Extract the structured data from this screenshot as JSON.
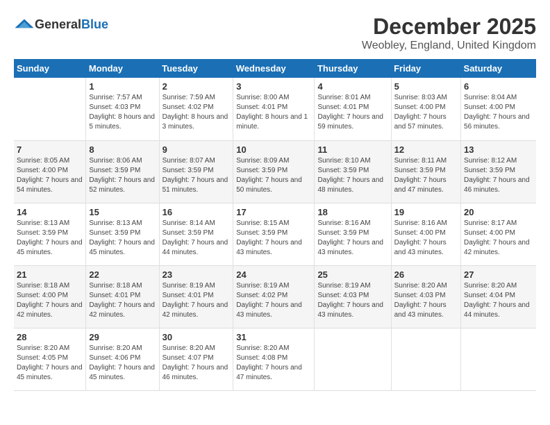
{
  "header": {
    "logo_general": "General",
    "logo_blue": "Blue",
    "month": "December 2025",
    "location": "Weobley, England, United Kingdom"
  },
  "days_of_week": [
    "Sunday",
    "Monday",
    "Tuesday",
    "Wednesday",
    "Thursday",
    "Friday",
    "Saturday"
  ],
  "weeks": [
    [
      {
        "day": "",
        "sunrise": "",
        "sunset": "",
        "daylight": ""
      },
      {
        "day": "1",
        "sunrise": "Sunrise: 7:57 AM",
        "sunset": "Sunset: 4:03 PM",
        "daylight": "Daylight: 8 hours and 5 minutes."
      },
      {
        "day": "2",
        "sunrise": "Sunrise: 7:59 AM",
        "sunset": "Sunset: 4:02 PM",
        "daylight": "Daylight: 8 hours and 3 minutes."
      },
      {
        "day": "3",
        "sunrise": "Sunrise: 8:00 AM",
        "sunset": "Sunset: 4:01 PM",
        "daylight": "Daylight: 8 hours and 1 minute."
      },
      {
        "day": "4",
        "sunrise": "Sunrise: 8:01 AM",
        "sunset": "Sunset: 4:01 PM",
        "daylight": "Daylight: 7 hours and 59 minutes."
      },
      {
        "day": "5",
        "sunrise": "Sunrise: 8:03 AM",
        "sunset": "Sunset: 4:00 PM",
        "daylight": "Daylight: 7 hours and 57 minutes."
      },
      {
        "day": "6",
        "sunrise": "Sunrise: 8:04 AM",
        "sunset": "Sunset: 4:00 PM",
        "daylight": "Daylight: 7 hours and 56 minutes."
      }
    ],
    [
      {
        "day": "7",
        "sunrise": "Sunrise: 8:05 AM",
        "sunset": "Sunset: 4:00 PM",
        "daylight": "Daylight: 7 hours and 54 minutes."
      },
      {
        "day": "8",
        "sunrise": "Sunrise: 8:06 AM",
        "sunset": "Sunset: 3:59 PM",
        "daylight": "Daylight: 7 hours and 52 minutes."
      },
      {
        "day": "9",
        "sunrise": "Sunrise: 8:07 AM",
        "sunset": "Sunset: 3:59 PM",
        "daylight": "Daylight: 7 hours and 51 minutes."
      },
      {
        "day": "10",
        "sunrise": "Sunrise: 8:09 AM",
        "sunset": "Sunset: 3:59 PM",
        "daylight": "Daylight: 7 hours and 50 minutes."
      },
      {
        "day": "11",
        "sunrise": "Sunrise: 8:10 AM",
        "sunset": "Sunset: 3:59 PM",
        "daylight": "Daylight: 7 hours and 48 minutes."
      },
      {
        "day": "12",
        "sunrise": "Sunrise: 8:11 AM",
        "sunset": "Sunset: 3:59 PM",
        "daylight": "Daylight: 7 hours and 47 minutes."
      },
      {
        "day": "13",
        "sunrise": "Sunrise: 8:12 AM",
        "sunset": "Sunset: 3:59 PM",
        "daylight": "Daylight: 7 hours and 46 minutes."
      }
    ],
    [
      {
        "day": "14",
        "sunrise": "Sunrise: 8:13 AM",
        "sunset": "Sunset: 3:59 PM",
        "daylight": "Daylight: 7 hours and 45 minutes."
      },
      {
        "day": "15",
        "sunrise": "Sunrise: 8:13 AM",
        "sunset": "Sunset: 3:59 PM",
        "daylight": "Daylight: 7 hours and 45 minutes."
      },
      {
        "day": "16",
        "sunrise": "Sunrise: 8:14 AM",
        "sunset": "Sunset: 3:59 PM",
        "daylight": "Daylight: 7 hours and 44 minutes."
      },
      {
        "day": "17",
        "sunrise": "Sunrise: 8:15 AM",
        "sunset": "Sunset: 3:59 PM",
        "daylight": "Daylight: 7 hours and 43 minutes."
      },
      {
        "day": "18",
        "sunrise": "Sunrise: 8:16 AM",
        "sunset": "Sunset: 3:59 PM",
        "daylight": "Daylight: 7 hours and 43 minutes."
      },
      {
        "day": "19",
        "sunrise": "Sunrise: 8:16 AM",
        "sunset": "Sunset: 4:00 PM",
        "daylight": "Daylight: 7 hours and 43 minutes."
      },
      {
        "day": "20",
        "sunrise": "Sunrise: 8:17 AM",
        "sunset": "Sunset: 4:00 PM",
        "daylight": "Daylight: 7 hours and 42 minutes."
      }
    ],
    [
      {
        "day": "21",
        "sunrise": "Sunrise: 8:18 AM",
        "sunset": "Sunset: 4:00 PM",
        "daylight": "Daylight: 7 hours and 42 minutes."
      },
      {
        "day": "22",
        "sunrise": "Sunrise: 8:18 AM",
        "sunset": "Sunset: 4:01 PM",
        "daylight": "Daylight: 7 hours and 42 minutes."
      },
      {
        "day": "23",
        "sunrise": "Sunrise: 8:19 AM",
        "sunset": "Sunset: 4:01 PM",
        "daylight": "Daylight: 7 hours and 42 minutes."
      },
      {
        "day": "24",
        "sunrise": "Sunrise: 8:19 AM",
        "sunset": "Sunset: 4:02 PM",
        "daylight": "Daylight: 7 hours and 43 minutes."
      },
      {
        "day": "25",
        "sunrise": "Sunrise: 8:19 AM",
        "sunset": "Sunset: 4:03 PM",
        "daylight": "Daylight: 7 hours and 43 minutes."
      },
      {
        "day": "26",
        "sunrise": "Sunrise: 8:20 AM",
        "sunset": "Sunset: 4:03 PM",
        "daylight": "Daylight: 7 hours and 43 minutes."
      },
      {
        "day": "27",
        "sunrise": "Sunrise: 8:20 AM",
        "sunset": "Sunset: 4:04 PM",
        "daylight": "Daylight: 7 hours and 44 minutes."
      }
    ],
    [
      {
        "day": "28",
        "sunrise": "Sunrise: 8:20 AM",
        "sunset": "Sunset: 4:05 PM",
        "daylight": "Daylight: 7 hours and 45 minutes."
      },
      {
        "day": "29",
        "sunrise": "Sunrise: 8:20 AM",
        "sunset": "Sunset: 4:06 PM",
        "daylight": "Daylight: 7 hours and 45 minutes."
      },
      {
        "day": "30",
        "sunrise": "Sunrise: 8:20 AM",
        "sunset": "Sunset: 4:07 PM",
        "daylight": "Daylight: 7 hours and 46 minutes."
      },
      {
        "day": "31",
        "sunrise": "Sunrise: 8:20 AM",
        "sunset": "Sunset: 4:08 PM",
        "daylight": "Daylight: 7 hours and 47 minutes."
      },
      {
        "day": "",
        "sunrise": "",
        "sunset": "",
        "daylight": ""
      },
      {
        "day": "",
        "sunrise": "",
        "sunset": "",
        "daylight": ""
      },
      {
        "day": "",
        "sunrise": "",
        "sunset": "",
        "daylight": ""
      }
    ]
  ]
}
